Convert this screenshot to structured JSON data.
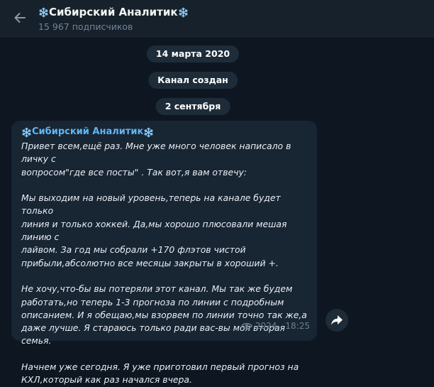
{
  "header": {
    "title": "Сибирский Аналитик",
    "subscribers": "15 967 подписчиков"
  },
  "service": {
    "date1": "14 марта 2020",
    "created": "Канал создан",
    "date2": "2 сентября"
  },
  "post": {
    "sender": "Сибирский Аналитик",
    "lines": [
      "Привет всем,ещё раз. Мне уже много человек написало в личку с",
      "вопросом\"где все посты\" . Так вот,я вам отвечу:",
      "",
      "Мы выходим на новый уровень,теперь на канале будет только",
      "линия и только хоккей. Да,мы хорошо плюсовали мешая линию с",
      "лайвом. За год мы собрали +170 флэтов чистой",
      "прибыли,абсолютно все месяцы закрыты в хороший +.",
      "",
      "Не хочу,что-бы вы потеряли этот канал. Мы так же будем",
      "работать,но теперь 1-3 прогноза по линии с подробным",
      "описанием. И я обещаю,мы взорвем по линии точно так же,а",
      "даже лучше. Я стараюсь только ради вас-вы моя вторая семья.",
      "",
      "Начнем уже сегодня. Я уже приготовил первый прогноз на",
      "КХЛ,который как раз начался вчера."
    ],
    "views": "2024",
    "time": "18:25"
  },
  "icons": {
    "back": "arrow-left-icon",
    "snowflake": "snowflake-icon",
    "views": "eye-icon",
    "forward": "forward-arrow-icon"
  },
  "colors": {
    "background": "#0e1621",
    "header": "#17212b",
    "bubble": "#182533",
    "sender": "#5fb6f2",
    "pill": "#1e2c3a",
    "snowflake": "#8fd0ff"
  }
}
